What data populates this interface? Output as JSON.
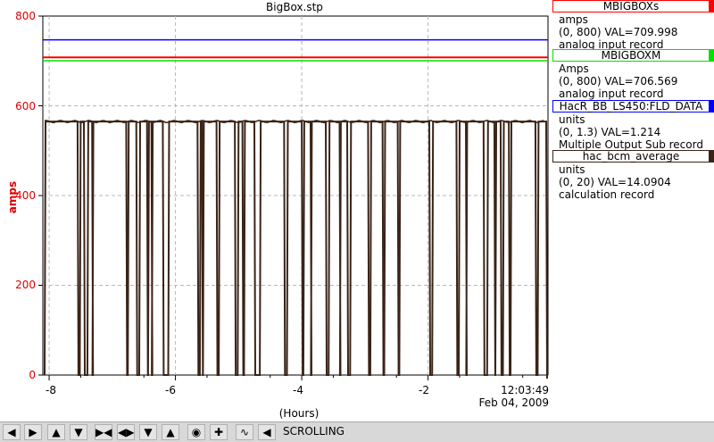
{
  "window": {
    "title": "BigBox.stp"
  },
  "y_axis": {
    "label": "amps",
    "ticks": [
      "800",
      "600",
      "400",
      "200",
      "0"
    ]
  },
  "x_axis": {
    "label": "(Hours)",
    "ticks": [
      "-8",
      "-6",
      "-4",
      "-2"
    ],
    "time": "12:03:49",
    "date": "Feb 04, 2009"
  },
  "legend": [
    {
      "name": "MBIGBOXs",
      "color": "#ff0000",
      "line1": "amps",
      "line2": "(0, 800)  VAL=709.998",
      "line3": "analog input record"
    },
    {
      "name": "MBIGBOXM",
      "color": "#00e000",
      "line1": "Amps",
      "line2": "(0, 800)  VAL=706.569",
      "line3": "analog input record"
    },
    {
      "name": "HacR_BB_LS450:FLD_DATA",
      "color": "#0000ff",
      "line1": "units",
      "line2": "(0, 1.3)  VAL=1.214",
      "line3": "Multiple Output Sub record"
    },
    {
      "name": "hac_bcm_average",
      "color": "#3a2418",
      "line1": "units",
      "line2": "(0, 20)  VAL=14.0904",
      "line3": "calculation record"
    }
  ],
  "toolbar": {
    "status": "SCROLLING",
    "buttons": [
      "arrow-left-icon",
      "arrow-right-icon",
      "arrow-up-icon",
      "arrow-down-icon",
      "zoom-in-x-icon",
      "zoom-out-x-icon",
      "zoom-in-y-icon",
      "zoom-out-y-icon",
      "autoscale-icon",
      "crosshair-icon",
      "scroll-icon",
      "pan-icon"
    ]
  },
  "chart_data": {
    "type": "line",
    "xlabel": "(Hours)",
    "ylabel": "amps",
    "xlim": [
      -8.1,
      -0.1
    ],
    "ylim": [
      0,
      800
    ],
    "grid": true,
    "series": [
      {
        "name": "MBIGBOXs",
        "color": "#ff0000",
        "constant": 709.998
      },
      {
        "name": "MBIGBOXM",
        "color": "#00e000",
        "constant": 706.569
      },
      {
        "name": "HacR_BB_LS450:FLD_DATA",
        "color": "#0000ff",
        "constant": 1.214,
        "range": [
          0,
          1.3
        ]
      },
      {
        "name": "hac_bcm_average",
        "color": "#3a2418",
        "range": [
          0,
          20
        ],
        "baseline": 565,
        "dropouts": [
          [
            -8.05,
            -7.98
          ],
          [
            -7.55,
            -7.5
          ],
          [
            -7.45,
            -7.38
          ],
          [
            -7.32,
            -7.3
          ],
          [
            -6.78,
            -6.74
          ],
          [
            -6.62,
            -6.56
          ],
          [
            -6.45,
            -6.42
          ],
          [
            -6.38,
            -6.36
          ],
          [
            -6.2,
            -6.1
          ],
          [
            -5.65,
            -5.6
          ],
          [
            -5.58,
            -5.55
          ],
          [
            -5.35,
            -5.3
          ],
          [
            -5.06,
            -5.0
          ],
          [
            -4.94,
            -4.9
          ],
          [
            -4.75,
            -4.65
          ],
          [
            -4.28,
            -4.22
          ],
          [
            -4.0,
            -3.96
          ],
          [
            -3.86,
            -3.84
          ],
          [
            -3.62,
            -3.56
          ],
          [
            -3.4,
            -3.38
          ],
          [
            -3.28,
            -3.22
          ],
          [
            -2.95,
            -2.9
          ],
          [
            -2.72,
            -2.68
          ],
          [
            -2.48,
            -2.44
          ],
          [
            -1.98,
            -1.92
          ],
          [
            -1.55,
            -1.5
          ],
          [
            -1.4,
            -1.38
          ],
          [
            -1.12,
            -1.05
          ],
          [
            -0.95,
            -0.92
          ],
          [
            -0.85,
            -0.8
          ],
          [
            -0.72,
            -0.68
          ],
          [
            -0.3,
            -0.25
          ]
        ]
      }
    ]
  }
}
